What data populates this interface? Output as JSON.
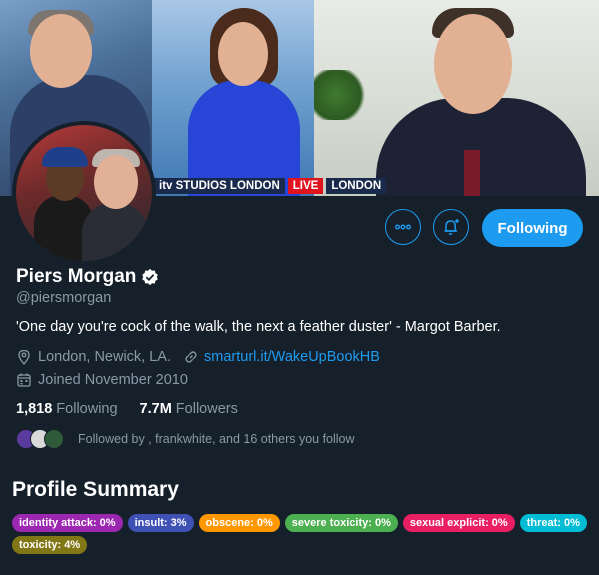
{
  "banner": {
    "chyron_studio": "STUDIOS LONDON",
    "chyron_brand": "itv",
    "chyron_live": "LIVE",
    "chyron_location": "LONDON"
  },
  "profile": {
    "name": "Piers Morgan",
    "handle": "@piersmorgan",
    "bio": "'One day you're cock of the walk, the next a feather duster' - Margot Barber.",
    "location": "London, Newick, LA.",
    "link": "smarturl.it/WakeUpBookHB",
    "joined": "Joined November 2010",
    "following_count": "1,818",
    "following_label": "Following",
    "followers_count": "7.7M",
    "followers_label": "Followers",
    "followed_by": "Followed by , frankwhite, and 16 others you follow"
  },
  "actions": {
    "follow_label": "Following",
    "more_icon": "more-icon",
    "notify_icon": "bell-plus-icon"
  },
  "summary": {
    "title": "Profile Summary",
    "badges": [
      {
        "label": "identity attack: 0%",
        "color": "#9c27b0"
      },
      {
        "label": "insult: 3%",
        "color": "#3f51b5"
      },
      {
        "label": "obscene: 0%",
        "color": "#ff9800"
      },
      {
        "label": "severe toxicity: 0%",
        "color": "#4caf50"
      },
      {
        "label": "sexual explicit: 0%",
        "color": "#e91e63"
      },
      {
        "label": "threat: 0%",
        "color": "#00bcd4"
      },
      {
        "label": "toxicity: 4%",
        "color": "#827717"
      }
    ]
  },
  "colors": {
    "background": "#15202b",
    "accent": "#1d9bf0",
    "secondary_text": "#8b98a5"
  }
}
